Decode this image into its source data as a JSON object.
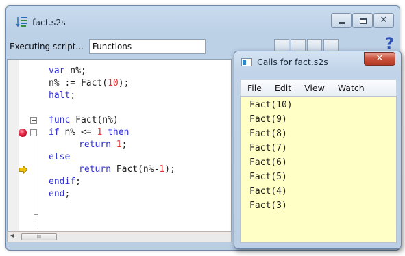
{
  "main_window": {
    "title": "fact.s2s",
    "icon": "script-sort-icon",
    "buttons": {
      "minimize": "minimize-icon",
      "maximize": "maximize-icon",
      "close_glyph": "✕"
    }
  },
  "toolbar": {
    "status": "Executing script...",
    "function_select": "Functions",
    "help_glyph": "?"
  },
  "editor": {
    "lines": [
      {
        "tokens": [
          [
            "var",
            "kw"
          ],
          [
            " n%;",
            "plain"
          ]
        ]
      },
      {
        "tokens": [
          [
            "n% := Fact(",
            "plain"
          ],
          [
            "10",
            "num"
          ],
          [
            ");",
            "plain"
          ]
        ]
      },
      {
        "tokens": [
          [
            "halt",
            "kw"
          ],
          [
            ";",
            "plain"
          ]
        ]
      },
      {
        "tokens": []
      },
      {
        "tokens": [
          [
            "func",
            "kw"
          ],
          [
            " Fact(n%)",
            "plain"
          ]
        ],
        "fold": "open"
      },
      {
        "tokens": [
          [
            "if",
            "kw"
          ],
          [
            " n% <= ",
            "plain"
          ],
          [
            "1",
            "num"
          ],
          [
            " then",
            "kw"
          ]
        ],
        "fold": "open",
        "marker": "breakpoint"
      },
      {
        "tokens": [
          [
            "return",
            "kw"
          ],
          [
            " ",
            "plain"
          ],
          [
            "1",
            "num"
          ],
          [
            ";",
            "plain"
          ]
        ],
        "indent": true
      },
      {
        "tokens": [
          [
            "else",
            "kw"
          ]
        ]
      },
      {
        "tokens": [
          [
            "return",
            "kw"
          ],
          [
            " Fact(n%-",
            "plain"
          ],
          [
            "1",
            "num"
          ],
          [
            ");",
            "plain"
          ]
        ],
        "indent": true,
        "marker": "current"
      },
      {
        "tokens": [
          [
            "endif",
            "kw"
          ],
          [
            ";",
            "plain"
          ]
        ]
      },
      {
        "tokens": [
          [
            "end",
            "kw"
          ],
          [
            ";",
            "plain"
          ]
        ]
      }
    ],
    "scrollbar_thumb_glyph": "III",
    "scroll_left_glyph": "◂"
  },
  "calls_window": {
    "title": "Calls for fact.s2s",
    "close_glyph": "✕",
    "menu": [
      "File",
      "Edit",
      "View",
      "Watch"
    ],
    "calls": [
      "Fact(10)",
      "Fact(9)",
      "Fact(8)",
      "Fact(7)",
      "Fact(6)",
      "Fact(5)",
      "Fact(4)",
      "Fact(3)"
    ]
  },
  "colors": {
    "keyword": "#3030d0",
    "number": "#e03030",
    "calls_background": "#ffffc6",
    "breakpoint": "#e22140",
    "current_line_arrow": "#f2c200"
  }
}
